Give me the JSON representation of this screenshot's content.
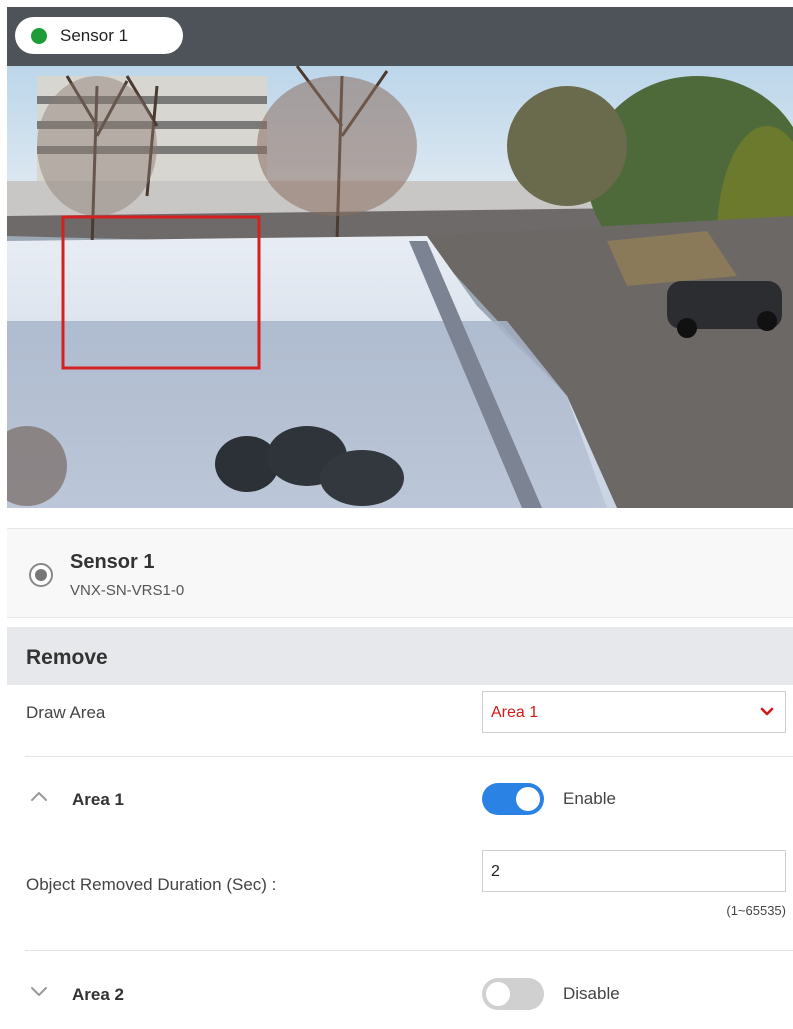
{
  "topbar": {
    "sensor_tab_label": "Sensor 1",
    "status_color": "#1f9c3a"
  },
  "video": {
    "detection_box_color": "#d42020"
  },
  "sensor_info": {
    "name": "Sensor 1",
    "id": "VNX-SN-VRS1-0"
  },
  "section": {
    "title": "Remove"
  },
  "draw_area": {
    "label": "Draw Area",
    "selected": "Area 1"
  },
  "areas": [
    {
      "title": "Area 1",
      "expanded": true,
      "enabled": true,
      "status_label": "Enable",
      "duration_label": "Object Removed Duration (Sec) :",
      "duration_value": "2",
      "duration_range": "(1~65535)"
    },
    {
      "title": "Area 2",
      "expanded": false,
      "enabled": false,
      "status_label": "Disable"
    }
  ],
  "colors": {
    "accent_blue": "#2a82e4",
    "select_text_red": "#d11a1a"
  }
}
